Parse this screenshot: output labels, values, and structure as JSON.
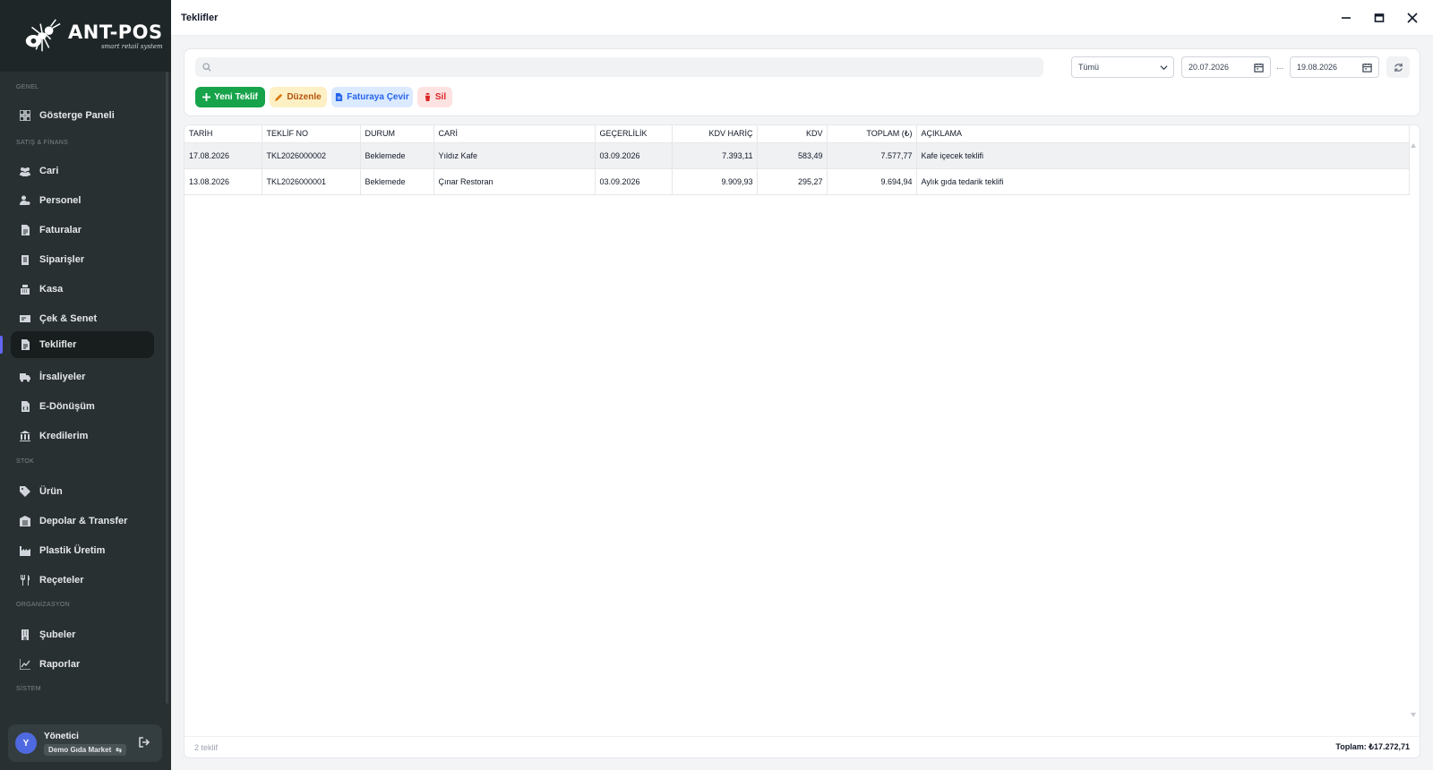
{
  "app": {
    "logo_title": "ANT-POS",
    "logo_subtitle": "smart retail system",
    "window_title": "Teklifler"
  },
  "sidebar": {
    "sections": {
      "genel": "GENEL",
      "satis": "SATIŞ & FİNANS",
      "stok": "STOK",
      "org": "ORGANİZASYON",
      "sistem": "SİSTEM"
    },
    "items": [
      {
        "label": "Gösterge Paneli",
        "icon": "dashboard-icon"
      },
      {
        "label": "Cari",
        "icon": "users-icon"
      },
      {
        "label": "Personel",
        "icon": "user-gear-icon"
      },
      {
        "label": "Faturalar",
        "icon": "invoice-icon"
      },
      {
        "label": "Siparişler",
        "icon": "clipboard-icon"
      },
      {
        "label": "Kasa",
        "icon": "cash-register-icon"
      },
      {
        "label": "Çek & Senet",
        "icon": "money-check-icon"
      },
      {
        "label": "Teklifler",
        "icon": "document-icon",
        "active": true
      },
      {
        "label": "İrsaliyeler",
        "icon": "truck-icon"
      },
      {
        "label": "E-Dönüşüm",
        "icon": "file-code-icon"
      },
      {
        "label": "Kredilerim",
        "icon": "bank-icon"
      },
      {
        "label": "Ürün",
        "icon": "tag-icon"
      },
      {
        "label": "Depolar & Transfer",
        "icon": "warehouse-icon"
      },
      {
        "label": "Plastik Üretim",
        "icon": "industry-icon"
      },
      {
        "label": "Reçeteler",
        "icon": "utensils-icon"
      },
      {
        "label": "Şubeler",
        "icon": "building-icon"
      },
      {
        "label": "Raporlar",
        "icon": "chart-line-icon"
      }
    ],
    "user": {
      "initial": "Y",
      "name": "Yönetici",
      "company": "Demo Gıda Market"
    }
  },
  "toolbar": {
    "search_placeholder": "",
    "status_filter": "Tümü",
    "date_from": "20.07.2026",
    "date_separator": "...",
    "date_to": "19.08.2026",
    "buttons": {
      "new": "Yeni Teklif",
      "edit": "Düzenle",
      "convert": "Faturaya Çevir",
      "delete": "Sil"
    }
  },
  "table": {
    "columns": [
      "TARİH",
      "TEKLİF NO",
      "DURUM",
      "CARİ",
      "GEÇERLİLİK",
      "KDV HARİÇ",
      "KDV",
      "TOPLAM (₺)",
      "AÇIKLAMA"
    ],
    "rows": [
      [
        "17.08.2026",
        "TKL2026000002",
        "Beklemede",
        "Yıldız Kafe",
        "03.09.2026",
        "7.393,11",
        "583,49",
        "7.577,77",
        "Kafe içecek teklifi"
      ],
      [
        "13.08.2026",
        "TKL2026000001",
        "Beklemede",
        "Çınar Restoran",
        "03.09.2026",
        "9.909,93",
        "295,27",
        "9.694,94",
        "Aylık gıda tedarik teklifi"
      ]
    ]
  },
  "footer": {
    "count": "2 teklif",
    "total": "Toplam: ₺17.272,71"
  },
  "colors": {
    "sidebar_bg": "#283032",
    "accent": "#6366f1",
    "new_button": "#16a34a",
    "edit_button": "#fdf0c4",
    "convert_button": "#dbeafe",
    "delete_button": "#fde2e2"
  }
}
